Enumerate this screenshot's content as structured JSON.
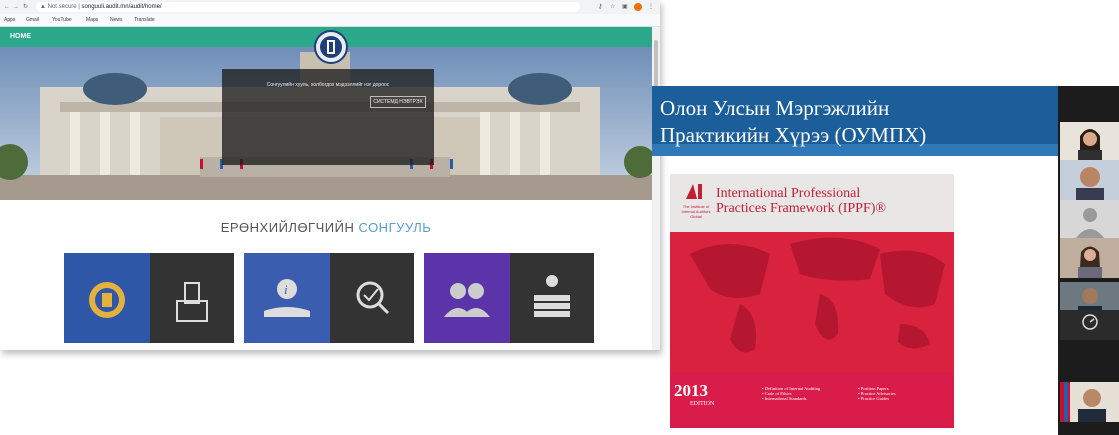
{
  "browser": {
    "security_label": "Not secure",
    "url": "songuuli.audit.mn/audit/home/",
    "bookmarks": [
      "Apps",
      "Gmail",
      "YouTube",
      "Maps",
      "News",
      "Translate"
    ]
  },
  "site": {
    "nav_home": "HOME",
    "hero_text": "Сонгуулийн хууль, холбогдох мэдээллийг нэг дороос",
    "hero_button": "СИСТЕМД НЭВТРЭХ",
    "section_title_main": "ЕРӨНХИЙЛӨГЧИЙН",
    "section_title_highlight": "СОНГУУЛЬ"
  },
  "tiles": [
    {
      "name": "tile-emblem",
      "icon": "state-emblem-icon",
      "color": "#2f57a8"
    },
    {
      "name": "tile-ballot",
      "icon": "ballot-box-icon",
      "color": "#333333"
    },
    {
      "name": "tile-info",
      "icon": "info-hand-icon",
      "color": "#3a5db0"
    },
    {
      "name": "tile-audit",
      "icon": "magnifier-check-icon",
      "color": "#333333"
    },
    {
      "name": "tile-people",
      "icon": "people-icon",
      "color": "#5a34a8"
    },
    {
      "name": "tile-books",
      "icon": "books-icon",
      "color": "#333333"
    }
  ],
  "slide": {
    "title_line1": "Олон Улсын Мэргэжлийн",
    "title_line2": "Практикийн Хүрээ (ОУМПХ)",
    "book_title_line1": "International Professional",
    "book_title_line2": "Practices Framework (IPPF)®",
    "book_org": "The Institute of Internal Auditors Global",
    "book_year": "2013",
    "book_edition": "EDITION",
    "bullets_left": [
      "• Definition of Internal Auditing",
      "• Code of Ethics",
      "• International Standards"
    ],
    "bullets_right": [
      "• Position Papers",
      "• Practice Advisories",
      "• Practice Guides"
    ]
  },
  "colors": {
    "nav": "#2aa889",
    "slide_header": "#1b5e9a",
    "book_red": "#d8223e"
  }
}
